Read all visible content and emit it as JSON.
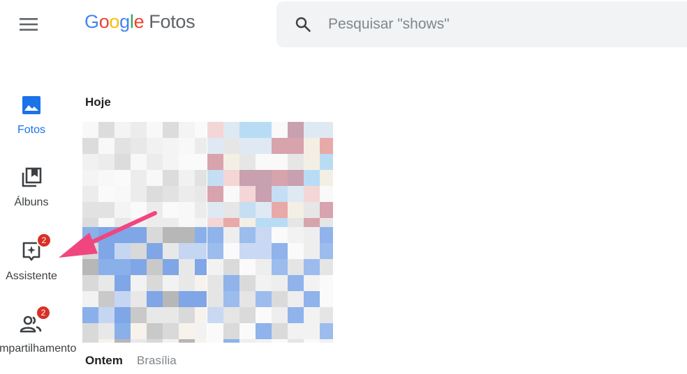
{
  "header": {
    "logo_letters": [
      "G",
      "o",
      "o",
      "g",
      "l",
      "e"
    ],
    "logo_product": "Fotos",
    "search_placeholder": "Pesquisar \"shows\""
  },
  "sidebar": {
    "items": [
      {
        "label": "Fotos",
        "icon": "photo-icon",
        "active": true
      },
      {
        "label": "Álbuns",
        "icon": "album-icon",
        "active": false
      },
      {
        "label": "Assistente",
        "icon": "assistant-icon",
        "badge": "2",
        "active": false
      },
      {
        "label": "Compartilhamento",
        "icon": "people-icon",
        "badge": "2",
        "active": false
      }
    ]
  },
  "main": {
    "sections": [
      {
        "title": "Hoje"
      },
      {
        "title": "Ontem",
        "subtitle": "Brasília"
      }
    ]
  },
  "colors": {
    "accent": "#1a73e8",
    "badge": "#d93025",
    "arrow": "#f0467f"
  }
}
